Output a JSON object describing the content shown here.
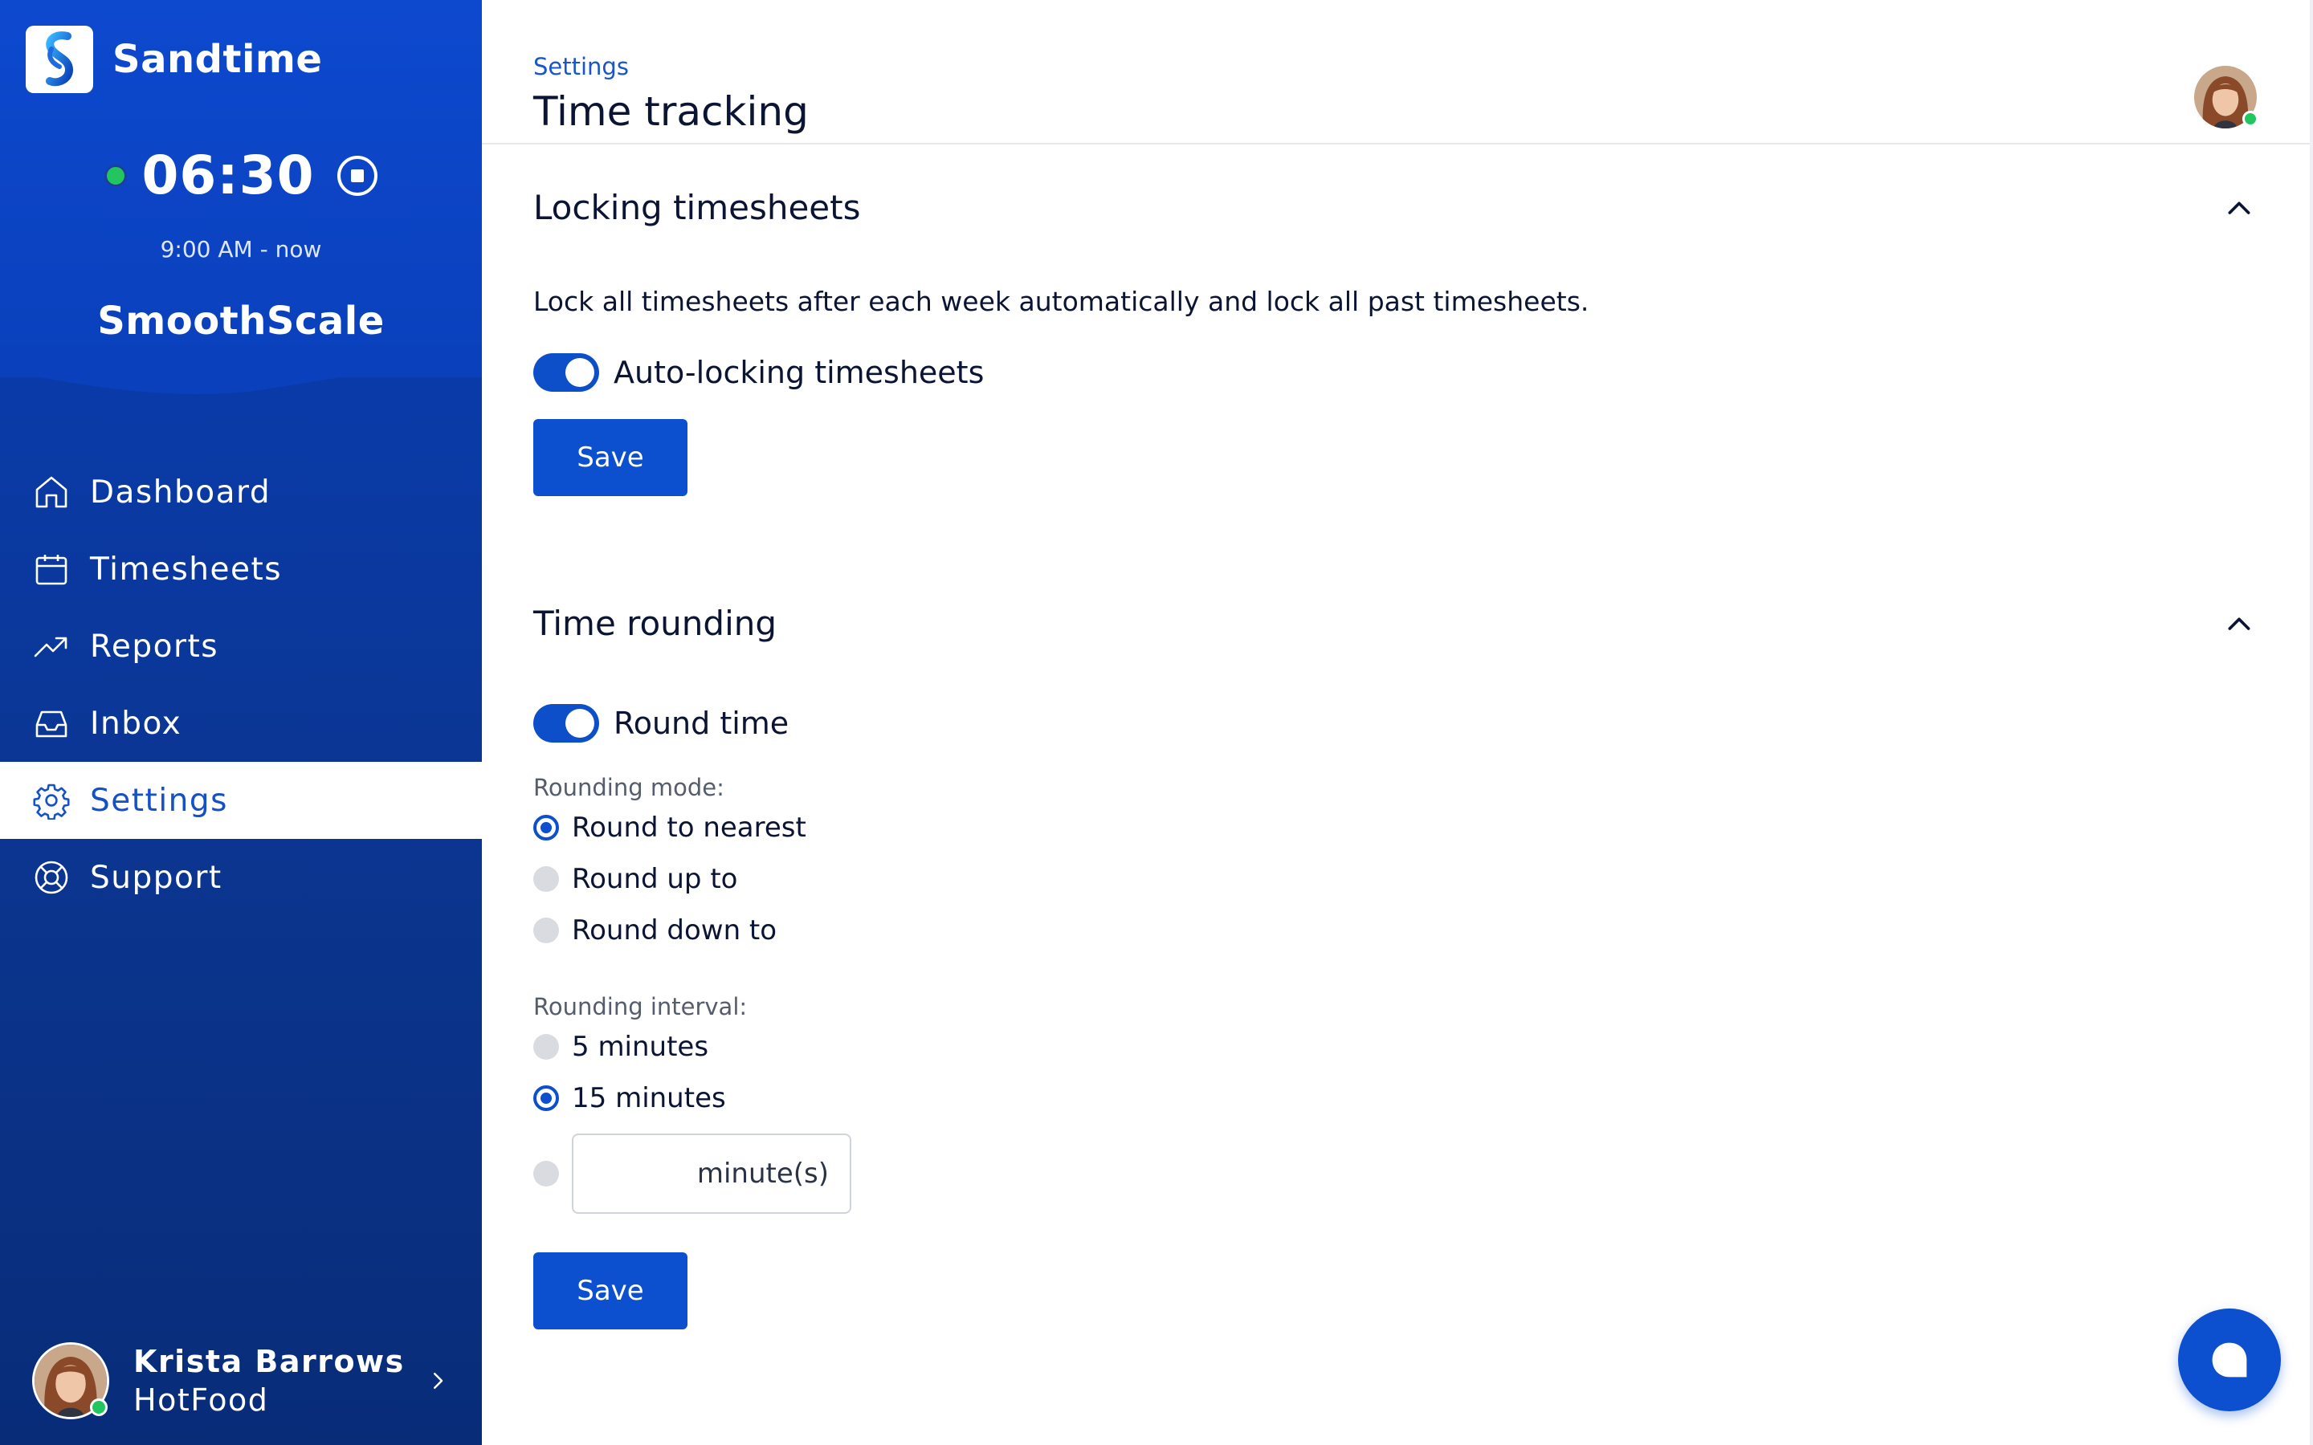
{
  "app": {
    "name": "Sandtime"
  },
  "timer": {
    "value": "06:30",
    "range": "9:00 AM - now",
    "status_color": "#22c55e"
  },
  "workspace": {
    "name": "SmoothScale"
  },
  "nav": {
    "items": [
      {
        "label": "Dashboard",
        "icon": "home-icon",
        "active": false
      },
      {
        "label": "Timesheets",
        "icon": "calendar-icon",
        "active": false
      },
      {
        "label": "Reports",
        "icon": "trending-up-icon",
        "active": false
      },
      {
        "label": "Inbox",
        "icon": "inbox-icon",
        "active": false
      },
      {
        "label": "Settings",
        "icon": "gear-icon",
        "active": true
      },
      {
        "label": "Support",
        "icon": "lifebuoy-icon",
        "active": false
      }
    ]
  },
  "user": {
    "name": "Krista Barrows",
    "org": "HotFood"
  },
  "header": {
    "breadcrumb": "Settings",
    "title": "Time tracking"
  },
  "locking": {
    "title": "Locking timesheets",
    "description": "Lock all timesheets after each week automatically and lock all past timesheets.",
    "toggle_label": "Auto-locking timesheets",
    "toggle_on": true,
    "save_label": "Save"
  },
  "rounding": {
    "title": "Time rounding",
    "toggle_label": "Round time",
    "toggle_on": true,
    "mode_label": "Rounding mode:",
    "modes": [
      {
        "label": "Round to nearest",
        "checked": true
      },
      {
        "label": "Round up to",
        "checked": false
      },
      {
        "label": "Round down to",
        "checked": false
      }
    ],
    "interval_label": "Rounding interval:",
    "intervals": [
      {
        "label": "5 minutes",
        "checked": false
      },
      {
        "label": "15 minutes",
        "checked": true
      }
    ],
    "custom_interval": {
      "value": "",
      "placeholder": "minute(s)",
      "checked": false
    },
    "save_label": "Save"
  },
  "colors": {
    "primary": "#0c4fcf",
    "sidebar": "#0a3aa6",
    "online": "#22c55e"
  },
  "chat": {
    "icon": "chat-bubble-icon"
  }
}
